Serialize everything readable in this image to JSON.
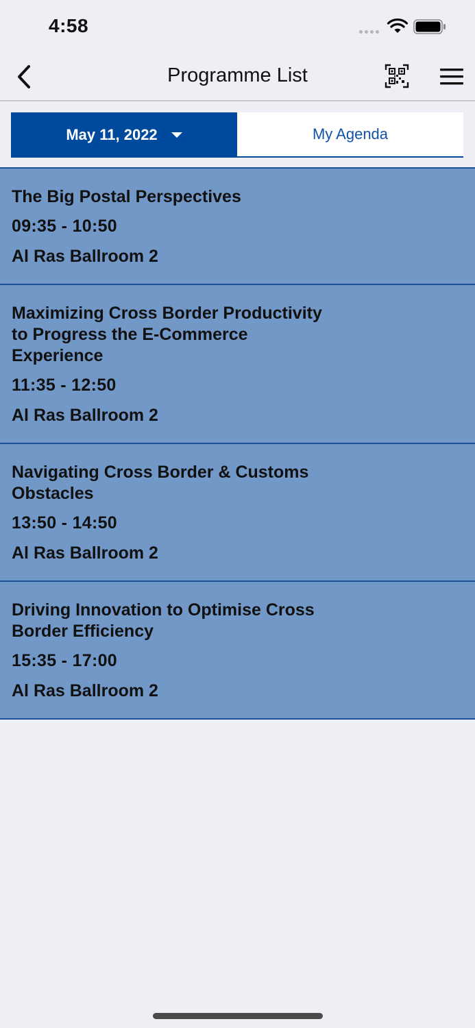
{
  "status_bar": {
    "time": "4:58"
  },
  "nav": {
    "title": "Programme List",
    "back_icon": "chevron-left-icon",
    "qr_icon": "qr-scan-icon",
    "menu_icon": "hamburger-menu-icon"
  },
  "tabs": {
    "date_label": "May 11, 2022",
    "agenda_label": "My Agenda"
  },
  "colors": {
    "primary": "#004a9d",
    "item_background": "#7298c8",
    "page_background": "#efeef4"
  },
  "sessions": [
    {
      "title": "The Big Postal Perspectives",
      "time": "09:35 - 10:50",
      "room": "Al Ras Ballroom 2"
    },
    {
      "title": "Maximizing Cross Border Productivity to Progress the E-Commerce Experience",
      "time": "11:35 - 12:50",
      "room": "Al Ras Ballroom 2"
    },
    {
      "title": "Navigating Cross Border & Customs Obstacles",
      "time": "13:50 - 14:50",
      "room": "Al Ras Ballroom 2"
    },
    {
      "title": "Driving Innovation to Optimise Cross Border Efficiency",
      "time": "15:35 - 17:00",
      "room": "Al Ras Ballroom 2"
    }
  ]
}
